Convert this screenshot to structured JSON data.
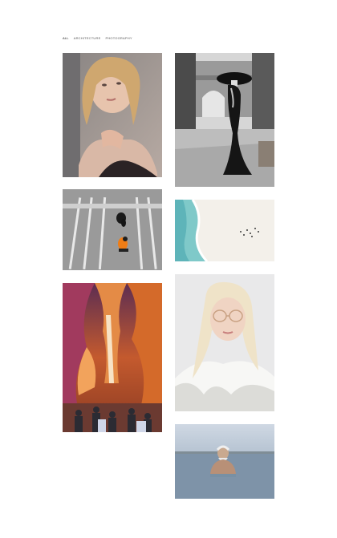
{
  "filters": {
    "all_label": "ALL",
    "architecture_label": "ARCHITECTURE",
    "photography_label": "PHOTOGRAPHY"
  },
  "gallery": {
    "items": [
      {
        "subject": "portrait-woman-blonde"
      },
      {
        "subject": "woman-black-dress-street"
      },
      {
        "subject": "people-crosswalk-aerial"
      },
      {
        "subject": "beach-aerial"
      },
      {
        "subject": "canyon-photographers"
      },
      {
        "subject": "woman-glasses-fur"
      },
      {
        "subject": "man-in-water"
      }
    ]
  }
}
